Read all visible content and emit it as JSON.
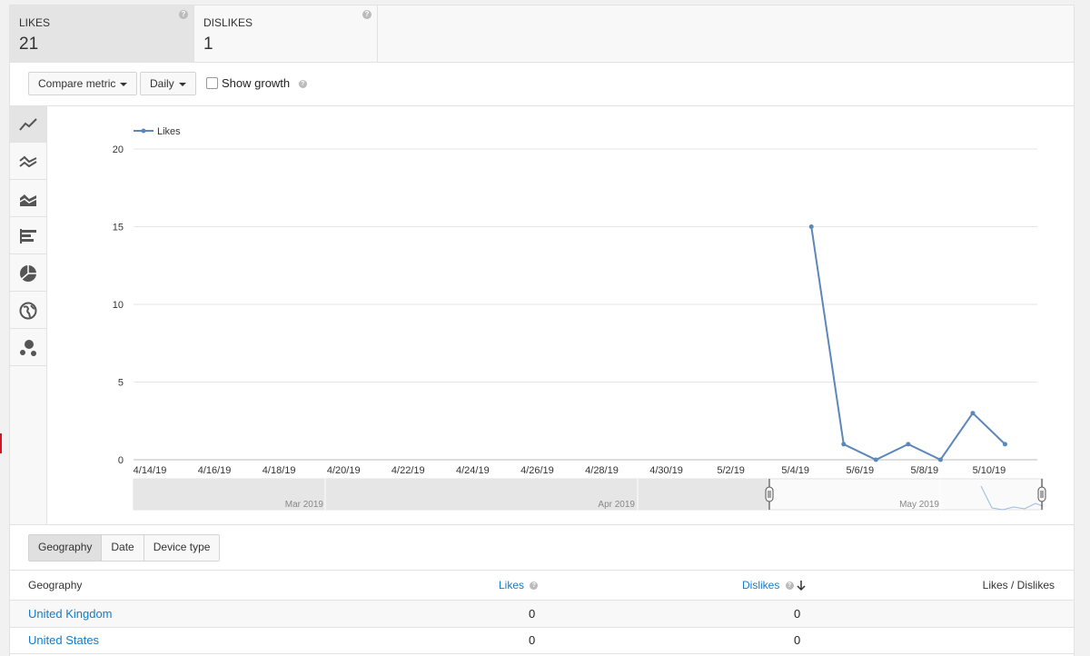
{
  "metrics": [
    {
      "label": "LIKES",
      "value": "21",
      "active": true
    },
    {
      "label": "DISLIKES",
      "value": "1",
      "active": false
    }
  ],
  "controls": {
    "compare_metric": "Compare metric",
    "interval": "Daily",
    "show_growth": "Show growth"
  },
  "chart_types": [
    "line-chart-icon",
    "multi-line-chart-icon",
    "stacked-area-chart-icon",
    "bar-chart-icon",
    "pie-chart-icon",
    "map-chart-icon",
    "bubble-chart-icon"
  ],
  "chart_data": {
    "type": "line",
    "series": [
      {
        "name": "Likes",
        "color": "#5b87ba",
        "points": [
          {
            "x": "5/5/19",
            "y": 15
          },
          {
            "x": "5/6/19",
            "y": 1
          },
          {
            "x": "5/7/19",
            "y": 0
          },
          {
            "x": "5/8/19",
            "y": 1
          },
          {
            "x": "5/9/19",
            "y": 0
          },
          {
            "x": "5/10/19",
            "y": 3
          },
          {
            "x": "5/11/19",
            "y": 1
          }
        ]
      }
    ],
    "x_ticks": [
      "4/14/19",
      "4/16/19",
      "4/18/19",
      "4/20/19",
      "4/22/19",
      "4/24/19",
      "4/26/19",
      "4/28/19",
      "4/30/19",
      "5/2/19",
      "5/4/19",
      "5/6/19",
      "5/8/19",
      "5/10/19"
    ],
    "x_range": [
      "4/14/19",
      "5/12/19"
    ],
    "y_ticks": [
      "0",
      "5",
      "10",
      "15",
      "20"
    ],
    "ylim": [
      0,
      20
    ],
    "grid": true,
    "legend_position": "top-left",
    "navigator_labels": [
      "Mar 2019",
      "Apr 2019",
      "May 2019"
    ]
  },
  "tabs": [
    "Geography",
    "Date",
    "Device type"
  ],
  "table": {
    "headers": {
      "geography": "Geography",
      "likes": "Likes",
      "dislikes": "Dislikes",
      "ratio": "Likes / Dislikes"
    },
    "rows": [
      {
        "geography": "United Kingdom",
        "likes": "0",
        "dislikes": "0",
        "ratio": ""
      },
      {
        "geography": "United States",
        "likes": "0",
        "dislikes": "0",
        "ratio": ""
      }
    ]
  }
}
